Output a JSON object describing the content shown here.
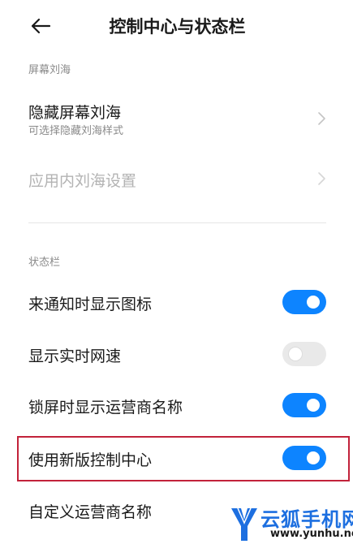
{
  "header": {
    "title": "控制中心与状态栏",
    "back_icon": "arrow-left-icon"
  },
  "notch_section": {
    "label": "屏幕刘海",
    "hide_notch": {
      "title": "隐藏屏幕刘海",
      "subtitle": "可选择隐藏刘海样式",
      "icon": "chevron-right-icon"
    },
    "in_app_notch": {
      "title": "应用内刘海设置",
      "disabled": true,
      "icon": "chevron-right-icon"
    }
  },
  "status_bar_section": {
    "label": "状态栏",
    "items": [
      {
        "title": "来通知时显示图标",
        "enabled": true
      },
      {
        "title": "显示实时网速",
        "enabled": false
      },
      {
        "title": "锁屏时显示运营商名称",
        "enabled": true
      },
      {
        "title": "使用新版控制中心",
        "enabled": true,
        "highlighted": true
      },
      {
        "title": "自定义运营商名称"
      }
    ]
  },
  "watermark": {
    "text": "云狐手机网",
    "url": "www.yunhu.net"
  },
  "colors": {
    "accent": "#0d84ff",
    "toggle_off": "#e9e9e9",
    "highlight_border": "#c2223a",
    "watermark": "#1d6fe0"
  }
}
